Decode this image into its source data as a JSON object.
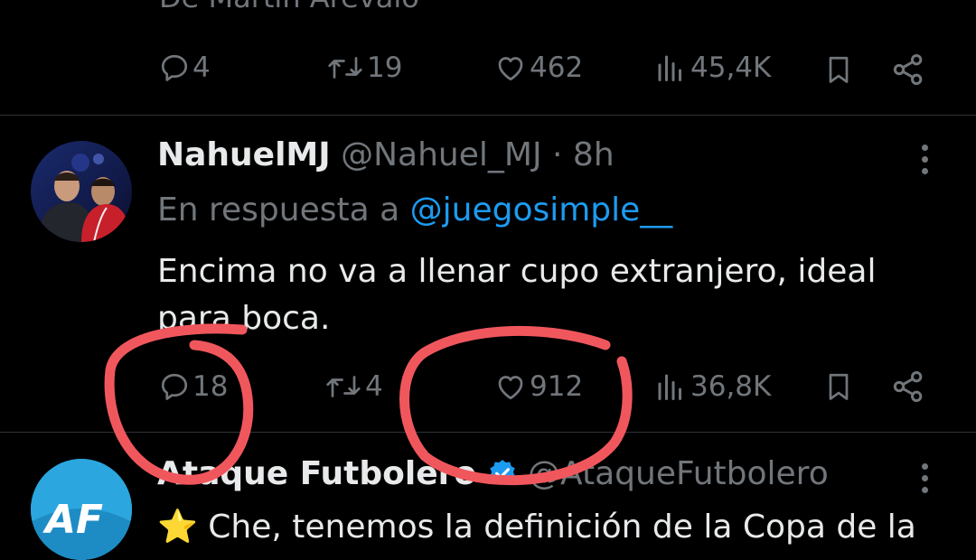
{
  "prev_tweet": {
    "partial_text": "De Martín Arévalo",
    "actions": {
      "replies": "4",
      "reposts": "19",
      "likes": "462",
      "views": "45,4K"
    }
  },
  "tweet": {
    "display_name": "NahuelMJ",
    "handle": "@Nahuel_MJ",
    "dot": "·",
    "time": "8h",
    "reply_prefix": "En respuesta a",
    "reply_to": "@juegosimple__",
    "text_line1": "Encima no va a llenar cupo extranjero, ideal",
    "text_line2": "para boca.",
    "actions": {
      "replies": "18",
      "reposts": "4",
      "likes": "912",
      "views": "36,8K"
    }
  },
  "next_tweet": {
    "display_name": "Ataque Futbolero",
    "handle": "@AtaqueFutbolero",
    "avatar_text": "AF",
    "emoji": "⭐",
    "text_partial": "Che, tenemos la definición de la Copa de la"
  },
  "colors": {
    "background": "#000000",
    "text": "#e7e9ea",
    "muted": "#71767b",
    "link": "#1d9bf0",
    "verified": "#1d9bf0",
    "annotation": "#f0575d",
    "divider": "#2f3336"
  },
  "icons": [
    "reply-icon",
    "repost-icon",
    "like-icon",
    "views-icon",
    "bookmark-icon",
    "share-icon",
    "more-icon",
    "verified-badge-icon",
    "star-icon"
  ]
}
